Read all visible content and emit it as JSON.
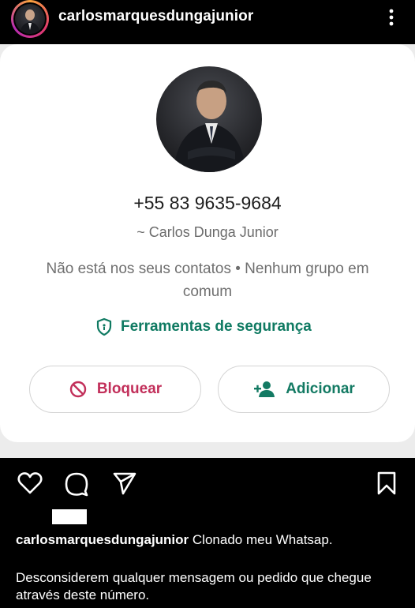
{
  "header": {
    "username": "carlosmarquesdungajunior",
    "more_icon": "more-vertical-icon"
  },
  "contact_card": {
    "phone": "+55 83 9635-9684",
    "push_name": "~ Carlos Dunga Junior",
    "info": "Não está nos seus contatos • Nenhum grupo em comum",
    "safety_tools_label": "Ferramentas de segurança",
    "block_label": "Bloquear",
    "add_label": "Adicionar",
    "colors": {
      "safety_green": "#0f7a62",
      "block_red": "#c22f5a",
      "add_green": "#137a63"
    }
  },
  "actions": {
    "like_icon": "heart-icon",
    "comment_icon": "comment-icon",
    "share_icon": "send-icon",
    "save_icon": "bookmark-icon"
  },
  "caption": {
    "username": "carlosmarquesdungajunior",
    "text": "Clonado meu Whatsap.",
    "text2": "Desconsiderem qualquer mensagem ou pedido que chegue através deste número."
  }
}
